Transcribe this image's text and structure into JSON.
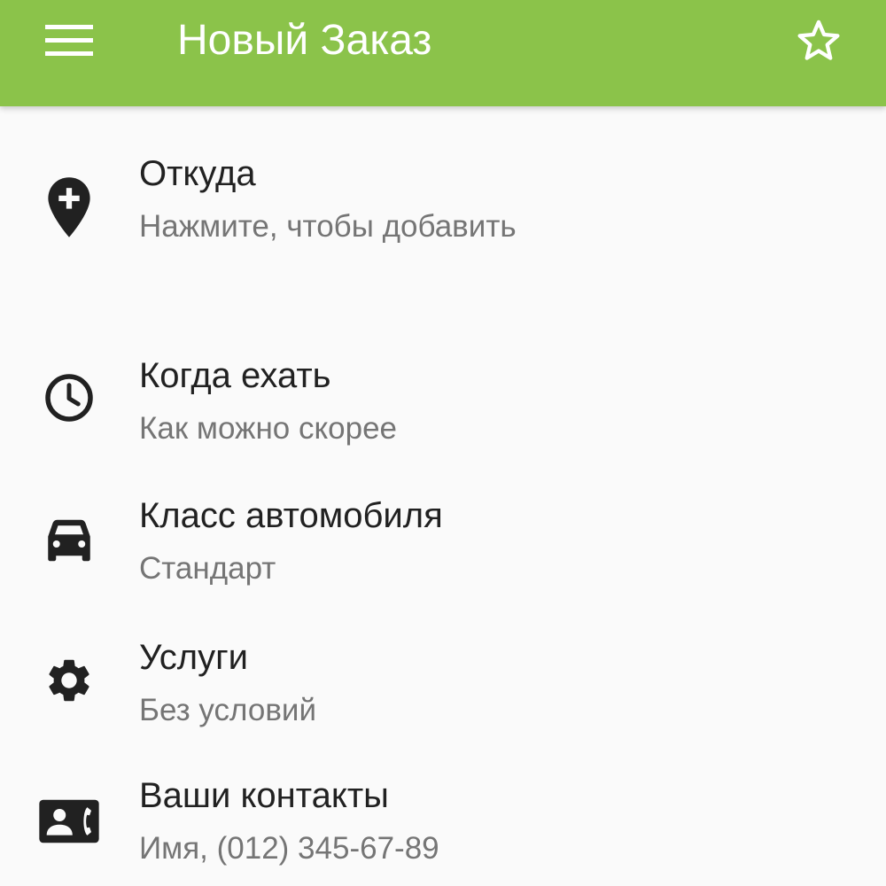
{
  "appbar": {
    "title": "Новый Заказ",
    "menu_icon": "menu-icon",
    "favorite_icon": "star-outline-icon",
    "color": "#8bc34a"
  },
  "form": {
    "items": [
      {
        "icon": "add-location-icon",
        "label": "Откуда",
        "value": "Нажмите, чтобы добавить"
      },
      {
        "icon": "clock-icon",
        "label": "Когда ехать",
        "value": "Как можно скорее"
      },
      {
        "icon": "car-icon",
        "label": "Класс автомобиля",
        "value": "Стандарт"
      },
      {
        "icon": "gear-icon",
        "label": "Услуги",
        "value": "Без условий"
      },
      {
        "icon": "contact-phone-icon",
        "label": "Ваши контакты",
        "value": "Имя, (012) 345-67-89"
      }
    ]
  }
}
